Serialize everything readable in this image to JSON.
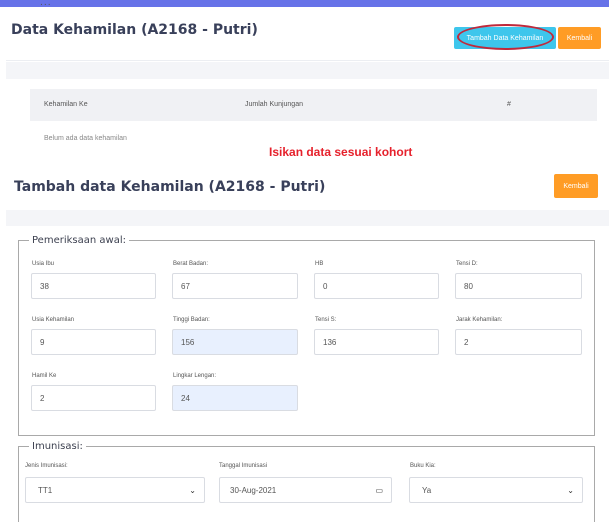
{
  "top_partial": "...",
  "panel1": {
    "title": "Data Kehamilan (A2168 - Putri)",
    "btn_tambah": "Tambah Data Kehamilan",
    "btn_kembali": "Kembali",
    "table_headers": [
      "Kehamilan Ke",
      "Jumlah Kunjungan",
      "#"
    ],
    "empty_text": "Belum ada data kehamilan",
    "note": "Isikan data sesuai kohort"
  },
  "panel2": {
    "title": "Tambah data Kehamilan (A2168 - Putri)",
    "btn_kembali": "Kembali"
  },
  "pemeriksaan": {
    "legend": "Pemeriksaan awal:",
    "fields": [
      {
        "label": "Usia Ibu",
        "value": "38"
      },
      {
        "label": "Berat Badan:",
        "value": "67"
      },
      {
        "label": "HB",
        "value": "0"
      },
      {
        "label": "Tensi D:",
        "value": "80"
      },
      {
        "label": "Usia Kehamilan",
        "value": "9"
      },
      {
        "label": "Tinggi Badan:",
        "value": "156"
      },
      {
        "label": "Tensi S:",
        "value": "136"
      },
      {
        "label": "Jarak Kehamilan:",
        "value": "2"
      },
      {
        "label": "Hamil Ke",
        "value": "2"
      },
      {
        "label": "Lingkar Lengan:",
        "value": "24"
      }
    ]
  },
  "imunisasi": {
    "legend": "Imunisasi:",
    "jenis_label": "Jenis Imunisasi:",
    "jenis_value": "TT1",
    "tanggal_label": "Tanggal Imunisasi",
    "tanggal_value": "30-Aug-2021",
    "buku_label": "Buku Kia:",
    "buku_value": "Ya"
  },
  "colors": {
    "accent_blue": "#3ec6ec",
    "accent_orange": "#ff9c25",
    "note_red": "#e6212c",
    "highlight": "#c0293b"
  }
}
